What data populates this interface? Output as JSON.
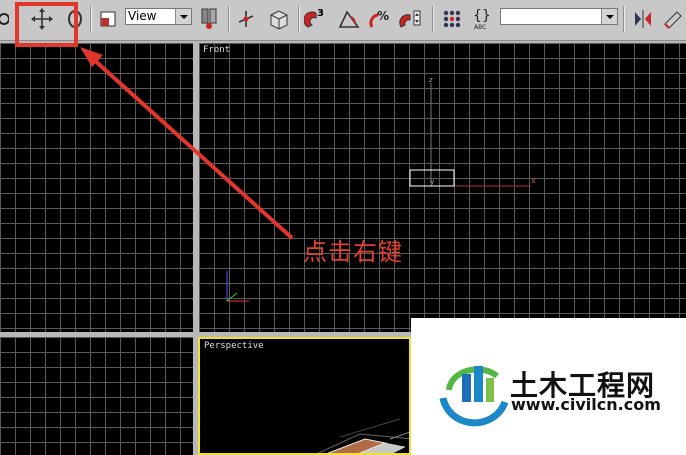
{
  "toolbar": {
    "view_dropdown": "View",
    "snap_angle_label": "3",
    "selection_set_dropdown": ""
  },
  "viewports": {
    "front": "Front",
    "perspective": "Perspective"
  },
  "annotation": "点击右键",
  "axes": {
    "x": "x",
    "y": "y",
    "z": "z"
  },
  "watermark": {
    "name": "土木工程网",
    "url": "www.civilcn.com"
  },
  "colors": {
    "highlight": "#e0362c",
    "annotation": "#e04030",
    "active_viewport_border": "#f0e030"
  }
}
